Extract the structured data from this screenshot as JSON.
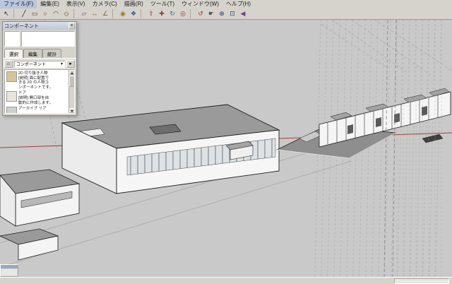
{
  "menu": {
    "items": [
      {
        "label": "ファイル(F)"
      },
      {
        "label": "編集(E)"
      },
      {
        "label": "表示(V)"
      },
      {
        "label": "カメラ(C)"
      },
      {
        "label": "描画(R)"
      },
      {
        "label": "ツール(T)"
      },
      {
        "label": "ウィンドウ(W)"
      },
      {
        "label": "ヘルプ(H)"
      }
    ]
  },
  "toolbar": {
    "icons": [
      {
        "name": "select-tool-icon",
        "glyph": "↖",
        "style": "color:#222"
      },
      {
        "name": "line-tool-icon",
        "glyph": "╱",
        "style": "color:#222"
      },
      {
        "name": "rectangle-tool-icon",
        "glyph": "▭",
        "style": "color:#5a3a1a"
      },
      {
        "name": "circle-tool-icon",
        "glyph": "○",
        "style": "color:#5a3a1a"
      },
      {
        "name": "arc-tool-icon",
        "glyph": "◠",
        "style": "color:#5a3a1a"
      },
      {
        "name": "polygon-tool-icon",
        "glyph": "◇",
        "style": "color:#5a3a1a"
      },
      {
        "name": "eraser-tool-icon",
        "glyph": "▱",
        "style": "color:#7a4a66"
      },
      {
        "name": "tape-measure-tool-icon",
        "glyph": "↔",
        "style": "color:#7a6a1a"
      },
      {
        "name": "protractor-tool-icon",
        "glyph": "∠",
        "style": "color:#7a6a1a"
      },
      {
        "name": "paint-bucket-tool-icon",
        "glyph": "◉",
        "style": "color:#a07818"
      },
      {
        "name": "make-component-tool-icon",
        "glyph": "❖",
        "style": "color:#335577"
      },
      {
        "name": "push-pull-tool-icon",
        "glyph": "⇧",
        "style": "color:#883322"
      },
      {
        "name": "move-tool-icon",
        "glyph": "✚",
        "style": "color:#993333"
      },
      {
        "name": "rotate-tool-icon",
        "glyph": "↻",
        "style": "color:#336699"
      },
      {
        "name": "offset-tool-icon",
        "glyph": "◎",
        "style": "color:#883333"
      },
      {
        "name": "orbit-tool-icon",
        "glyph": "↺",
        "style": "color:#b03030"
      },
      {
        "name": "pan-tool-icon",
        "glyph": "☛",
        "style": "color:#555555"
      },
      {
        "name": "zoom-tool-icon",
        "glyph": "⊕",
        "style": "color:#224488"
      },
      {
        "name": "zoom-extents-tool-icon",
        "glyph": "⊡",
        "style": "color:#224488"
      },
      {
        "name": "previous-view-tool-icon",
        "glyph": "◀",
        "style": "color:#664488"
      }
    ]
  },
  "components_panel": {
    "title": "コンポーネント",
    "close_glyph": "×",
    "tabs": [
      {
        "label": "選択"
      },
      {
        "label": "編集"
      },
      {
        "label": "統計"
      }
    ],
    "nav": {
      "home_glyph": "⌂",
      "collection_value": "コンポーネント",
      "dropdown_glyph": "▾",
      "detail_glyph": "▸"
    },
    "items": [
      {
        "text": "2D 切り抜き人物\n[説明] 面に配置で\nきる 2D の人物コ\nンポーネントです。",
        "thumb_style": "background:#d8c49c"
      },
      {
        "text": "ドア\n[説明] 開口部を自\n動的に作成します。",
        "thumb_style": "background:#e8e4da"
      },
      {
        "text": "アーカイブ リア",
        "thumb_style": "background:#cfcfcf"
      }
    ]
  },
  "viewport": {
    "bg_color": "#c9c9c9",
    "axis_color": "#b23b3b",
    "guide_color": "#a8a8a8",
    "edge_color": "#1c1c1c",
    "roof_color": "#9a9a9a",
    "wall_color": "#f5f5f5"
  },
  "status_bar": {
    "hint": "",
    "measurement_value": ""
  }
}
